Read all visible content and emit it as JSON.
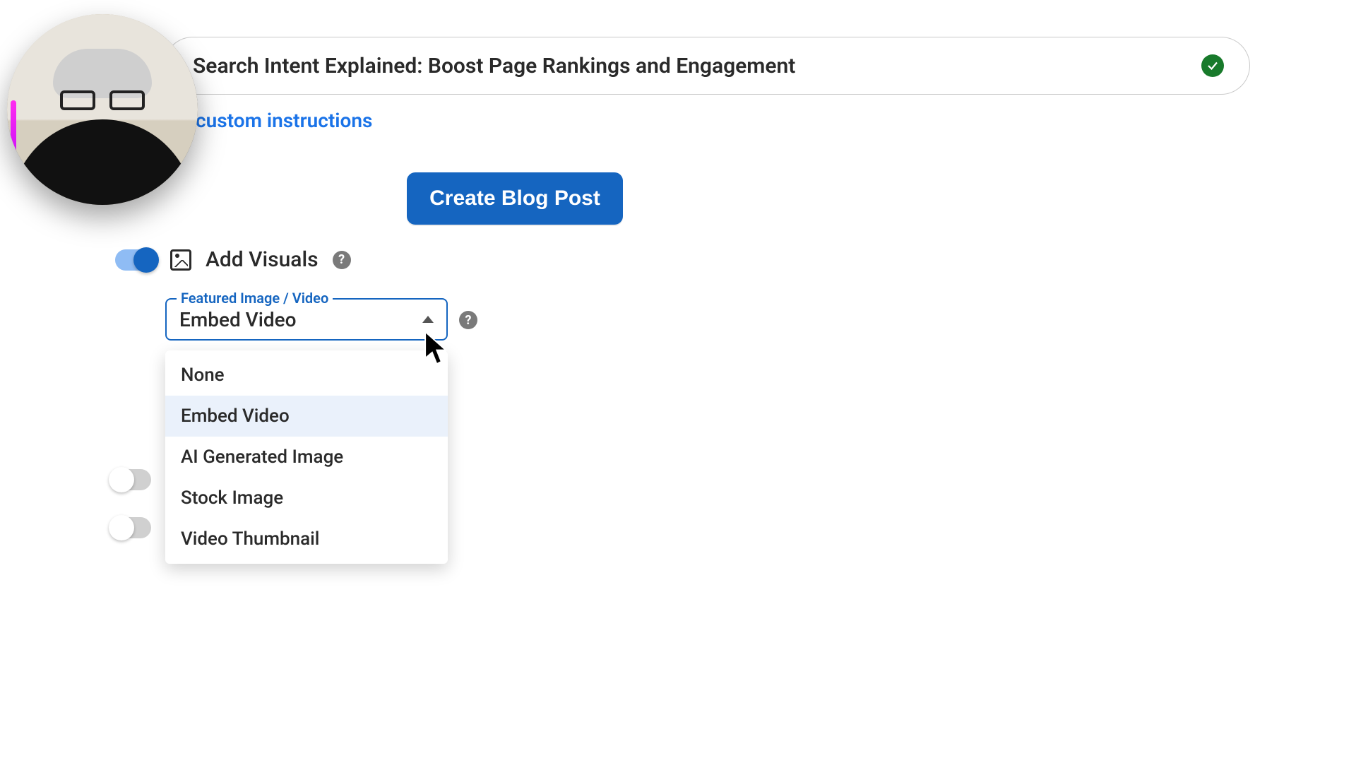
{
  "title_input": "Search Intent Explained: Boost Page Rankings and Engagement",
  "custom_instructions_link": "r custom instructions",
  "create_button": "Create Blog Post",
  "visuals": {
    "label": "Add Visuals",
    "toggle_on": true
  },
  "featured_dropdown": {
    "legend": "Featured Image / Video",
    "value": "Embed Video",
    "options": [
      "None",
      "Embed Video",
      "AI Generated Image",
      "Stock Image",
      "Video Thumbnail"
    ],
    "selected_index": 1
  },
  "help_glyph": "?"
}
